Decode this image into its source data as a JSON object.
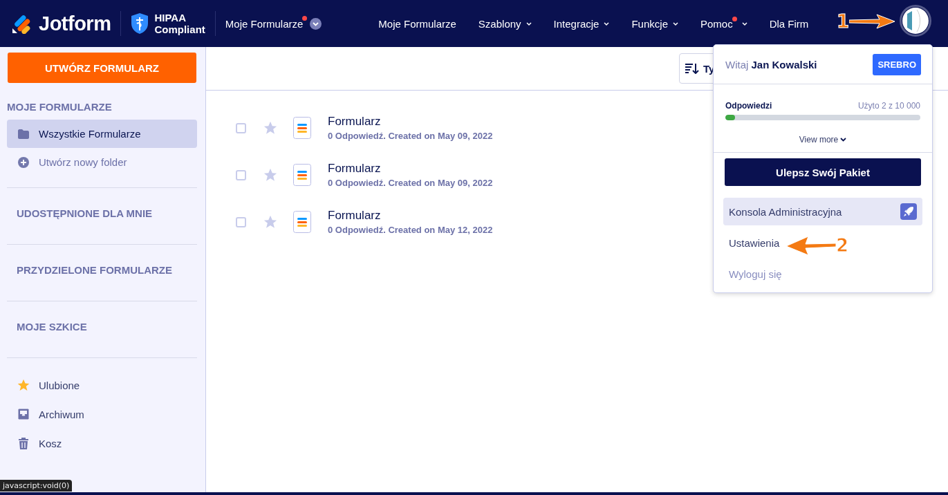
{
  "header": {
    "logo": "Jotform",
    "badge_line1": "HIPAA",
    "badge_line2": "Compliant",
    "context_menu": {
      "label": "Moje Formularze",
      "notification": true
    },
    "nav": [
      {
        "label": "Moje Formularze",
        "dropdown": false,
        "notification": false
      },
      {
        "label": "Szablony",
        "dropdown": true,
        "notification": false
      },
      {
        "label": "Integracje",
        "dropdown": true,
        "notification": false
      },
      {
        "label": "Funkcje",
        "dropdown": true,
        "notification": false
      },
      {
        "label": "Pomoc",
        "dropdown": true,
        "notification": true
      },
      {
        "label": "Dla Firm",
        "dropdown": false,
        "notification": false
      }
    ]
  },
  "sidebar": {
    "create_button": "UTWÓRZ FORMULARZ",
    "section_title": "MOJE FORMULARZE",
    "items": [
      {
        "label": "Wszystkie Formularze",
        "kind": "folder",
        "selected": true
      },
      {
        "label": "Utwórz nowy folder",
        "kind": "add",
        "selected": false
      }
    ],
    "sections": [
      "UDOSTĘPNIONE DLA MNIE",
      "PRZYDZIELONE FORMULARZE",
      "MOJE SZKICE"
    ],
    "bottom_items": [
      {
        "label": "Ulubione",
        "kind": "star"
      },
      {
        "label": "Archiwum",
        "kind": "archive"
      },
      {
        "label": "Kosz",
        "kind": "trash"
      }
    ]
  },
  "toolbar": {
    "sort_button": "Ty"
  },
  "forms": [
    {
      "title": "Formularz",
      "meta": "0 Odpowiedź. Created on May 09, 2022",
      "checked": false,
      "starred": false
    },
    {
      "title": "Formularz",
      "meta": "0 Odpowiedź. Created on May 09, 2022",
      "checked": false,
      "starred": false
    },
    {
      "title": "Formularz",
      "meta": "0 Odpowiedź. Created on May 12, 2022",
      "checked": false,
      "starred": false
    }
  ],
  "account_menu": {
    "greeting": "Witaj",
    "user": "Jan Kowalski",
    "plan": "SREBRO",
    "usage_label": "Odpowiedzi",
    "usage_text": "Użyto 2 z 10 000",
    "level": 0.05,
    "view_more": "View more",
    "upgrade_button": "Ulepsz Swój Pakiet",
    "items": [
      {
        "label": "Konsola Administracyjna",
        "kind": "admin",
        "selected": true
      },
      {
        "label": "Ustawienia",
        "kind": "plain",
        "selected": false
      },
      {
        "label": "Wyloguj się",
        "kind": "logout",
        "selected": false
      }
    ]
  },
  "annotations": [
    {
      "number": "1"
    },
    {
      "number": "2"
    }
  ],
  "status_tooltip": "javascript:void(0)"
}
